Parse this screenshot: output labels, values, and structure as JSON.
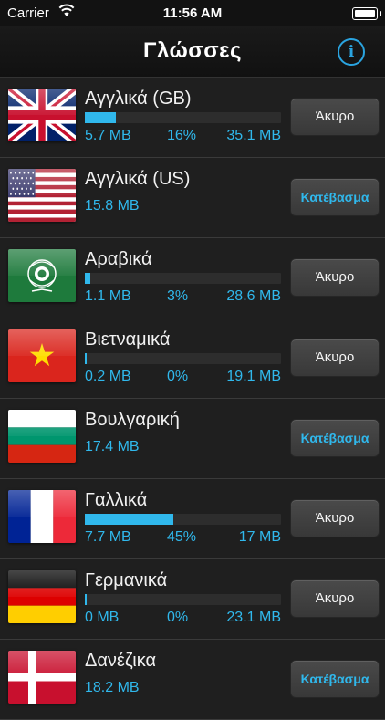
{
  "status_bar": {
    "carrier": "Carrier",
    "time": "11:56 AM"
  },
  "nav": {
    "title": "Γλώσσες",
    "info_icon": "info-icon",
    "info_glyph": "i"
  },
  "accent_color": "#30b8ec",
  "languages": [
    {
      "flag": "gb-flag",
      "name": "Αγγλικά (GB)",
      "progress": 0.16,
      "done": "5.7 MB",
      "percent": "16%",
      "total": "35.1 MB",
      "action": "Άκυρο"
    },
    {
      "flag": "us-flag",
      "name": "Αγγλικά (US)",
      "size": "15.8 MB",
      "action": "Κατέβασμα"
    },
    {
      "flag": "arab-league-flag",
      "name": "Αραβικά",
      "progress": 0.03,
      "done": "1.1 MB",
      "percent": "3%",
      "total": "28.6 MB",
      "action": "Άκυρο"
    },
    {
      "flag": "vietnam-flag",
      "name": "Βιετναμικά",
      "progress": 0.0,
      "done": "0.2 MB",
      "percent": "0%",
      "total": "19.1 MB",
      "action": "Άκυρο"
    },
    {
      "flag": "bulgaria-flag",
      "name": "Βουλγαρική",
      "size": "17.4 MB",
      "action": "Κατέβασμα"
    },
    {
      "flag": "france-flag",
      "name": "Γαλλικά",
      "progress": 0.45,
      "done": "7.7 MB",
      "percent": "45%",
      "total": "17 MB",
      "action": "Άκυρο"
    },
    {
      "flag": "germany-flag",
      "name": "Γερμανικά",
      "progress": 0.0,
      "done": "0 MB",
      "percent": "0%",
      "total": "23.1 MB",
      "action": "Άκυρο"
    },
    {
      "flag": "denmark-flag",
      "name": "Δανέζικα",
      "size": "18.2 MB",
      "action": "Κατέβασμα"
    }
  ]
}
